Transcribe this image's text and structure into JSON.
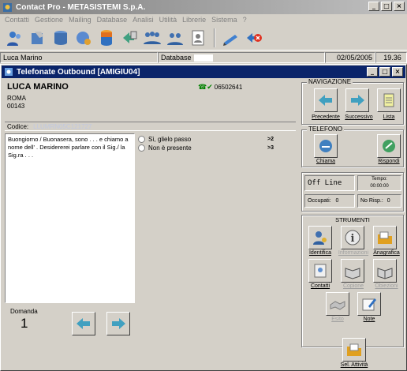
{
  "app": {
    "title": "Contact Pro - METASISTEMI S.p.A.",
    "controls": [
      "_",
      "□",
      "×"
    ]
  },
  "menu": [
    "Contatti",
    "Gestione",
    "Mailing",
    "Database",
    "Analisi",
    "Utilità",
    "Librerie",
    "Sistema",
    "?"
  ],
  "toolbar_icons": [
    "users-icon",
    "phone-icon",
    "database-stack-icon",
    "disk-search-icon",
    "database-icon",
    "arrows-icon",
    "people-group-icon",
    "people-pair-icon",
    "document-person-icon",
    "pen-icon",
    "exit-icon"
  ],
  "status": {
    "user": "Luca Marino",
    "db_label": "Database",
    "db_value": "",
    "date": "02/05/2005",
    "time": "19.36"
  },
  "child": {
    "title": "Telefonate Outbound [AMIGIU04]",
    "controls": [
      "_",
      "□",
      "×"
    ]
  },
  "contact": {
    "name": "LUCA MARINO",
    "city": "ROMA",
    "zip": "00143",
    "phone": "06502641",
    "code_label": "Codice:",
    "code_value": "LLUMRN05C121727"
  },
  "script": {
    "text": "Buongiorno / Buonasera, sono . . . e chiamo a nome dell'           . Desidererei parlare con il Sig./ la Sig.ra . . .",
    "answers": [
      {
        "label": "Sì, glielo passo",
        "next": ">2"
      },
      {
        "label": "Non è presente",
        "next": ">3"
      }
    ],
    "domanda_label": "Domanda",
    "domanda_value": "1"
  },
  "navigazione": {
    "label": "NAVIGAZIONE",
    "buttons": [
      "Precedente",
      "Successivo",
      "Lista"
    ]
  },
  "telefono": {
    "label": "TELEFONO",
    "buttons": [
      "Chiama",
      "Rispondi"
    ]
  },
  "line": {
    "status": "Off Line",
    "tempo_label": "Tempo:",
    "tempo_value": "00:00:00",
    "occupati_label": "Occupati:",
    "occupati_value": "0",
    "norisp_label": "No Risp.:",
    "norisp_value": "0"
  },
  "strumenti": {
    "label": "STRUMENTI",
    "buttons": [
      "Identifica",
      "Informazioni",
      "Anagrafica",
      "Contatti",
      "Copione",
      "Obiezioni",
      "Esito",
      "Note"
    ],
    "sel_label": "Sel. Attività"
  },
  "colors": {
    "face": "#d4d0c8",
    "title_active": "#0a246a",
    "title_inactive": "#808080"
  }
}
